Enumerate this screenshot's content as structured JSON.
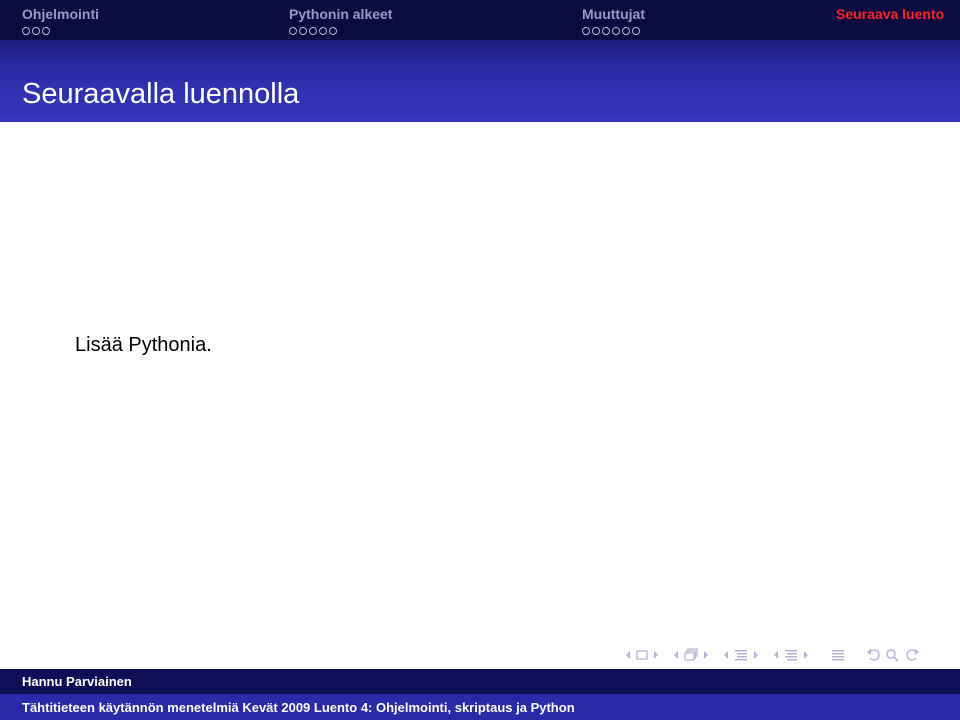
{
  "nav": {
    "sections": [
      {
        "label": "Ohjelmointi",
        "dots": 3,
        "color": "#9a9ac4",
        "dot_color": "#b8b8d0"
      },
      {
        "label": "Pythonin alkeet",
        "dots": 5,
        "color": "#9a9ac4",
        "dot_color": "#b8b8d0"
      },
      {
        "label": "Muuttujat",
        "dots": 6,
        "color": "#9a9ac4",
        "dot_color": "#b8b8d0"
      },
      {
        "label": "Seuraava luento",
        "dots": 0,
        "color": "#ff2020",
        "dot_color": "#b8b8d0"
      }
    ]
  },
  "frame": {
    "title": "Seuraavalla luennolla",
    "body": "Lisää Pythonia."
  },
  "footer": {
    "author": "Hannu Parviainen",
    "title": "Tähtitieteen käytännön menetelmiä Kevät 2009 Luento 4: Ohjelmointi, skriptaus ja Python"
  },
  "colors": {
    "nav_bg": "#0b0b3f",
    "title_band": "#3636bf",
    "footer_author_bg": "#0f0f57",
    "footer_title_bg": "#2a2aa8",
    "current_section": "#ff2020",
    "nav_symbols": "#b3b3d6"
  },
  "nav_symbols": [
    "slide-prev-icon",
    "slide-icon",
    "slide-next-icon",
    "frame-prev-icon",
    "frame-icon",
    "frame-next-icon",
    "subsection-prev-icon",
    "subsection-icon",
    "subsection-next-icon",
    "section-prev-icon",
    "section-icon",
    "section-next-icon",
    "toc-icon",
    "back-icon",
    "search-icon",
    "forward-icon"
  ]
}
